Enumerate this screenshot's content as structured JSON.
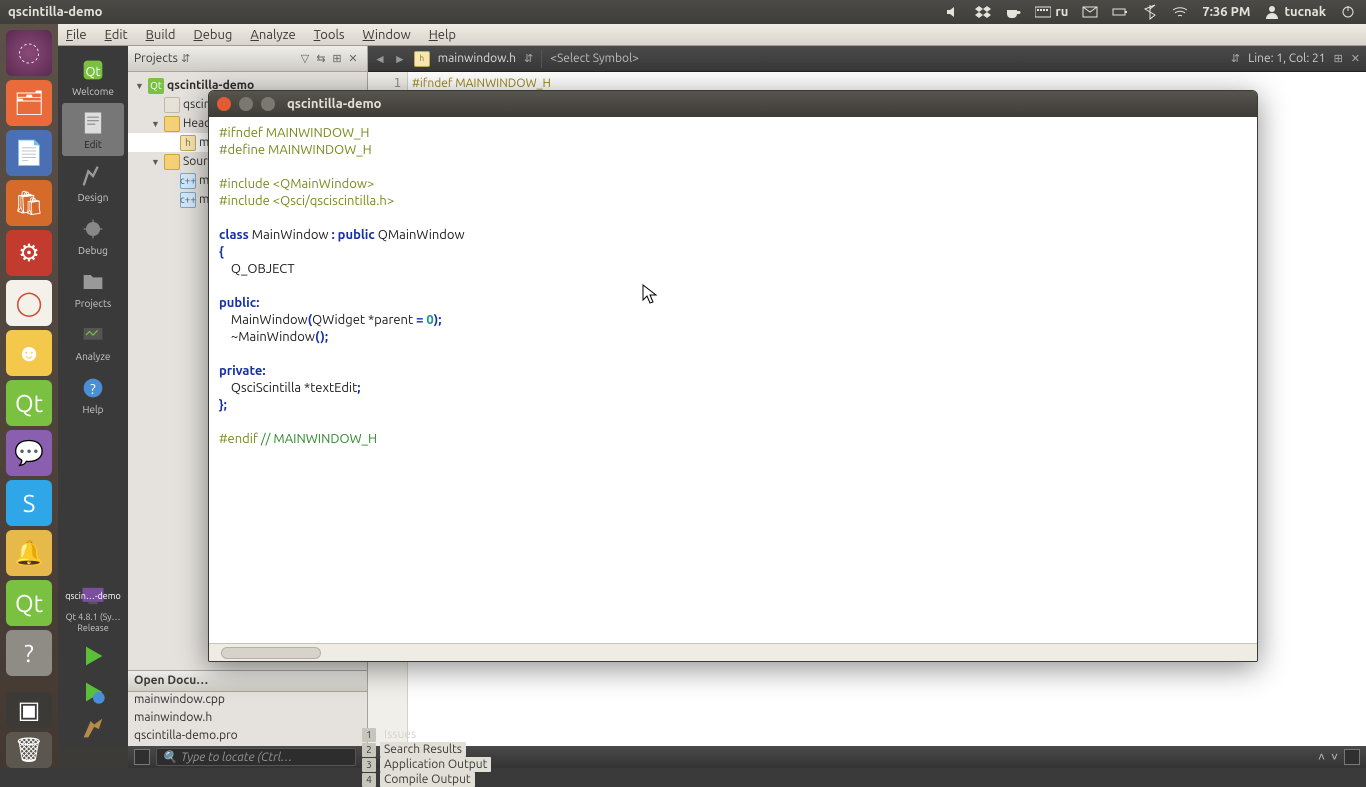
{
  "panel": {
    "title": "qscintilla-demo",
    "lang": "ru",
    "time": "7:36 PM",
    "user": "tucnak"
  },
  "unity": {
    "running_label": "qscin…-demo"
  },
  "menus": [
    "File",
    "Edit",
    "Build",
    "Debug",
    "Analyze",
    "Tools",
    "Window",
    "Help"
  ],
  "modes": {
    "items": [
      "Welcome",
      "Edit",
      "Design",
      "Debug",
      "Projects",
      "Analyze",
      "Help"
    ],
    "active": "Edit",
    "kit_line1": "Qt 4.8.1 (Sy…",
    "kit_line2": "Release"
  },
  "projects": {
    "header": "Projects",
    "tree": [
      {
        "depth": 0,
        "twisty": "▼",
        "icon": "qt",
        "label": "qscintilla-demo",
        "bold": true
      },
      {
        "depth": 1,
        "twisty": "",
        "icon": "pro",
        "label": "qscintilla-demo.pro"
      },
      {
        "depth": 1,
        "twisty": "▼",
        "icon": "fld",
        "label": "Headers"
      },
      {
        "depth": 2,
        "twisty": "",
        "icon": "h",
        "label": "mainwindow.h",
        "sel": true
      },
      {
        "depth": 1,
        "twisty": "▼",
        "icon": "fld",
        "label": "Sources"
      },
      {
        "depth": 2,
        "twisty": "",
        "icon": "cpp",
        "label": "main.cpp"
      },
      {
        "depth": 2,
        "twisty": "",
        "icon": "cpp",
        "label": "mainwindow.cpp"
      }
    ],
    "open_header": "Open Docu…",
    "open_docs": [
      "mainwindow.cpp",
      "mainwindow.h",
      "qscintilla-demo.pro"
    ]
  },
  "editor_header": {
    "file": "mainwindow.h",
    "symbol": "<Select Symbol>",
    "pos": "Line: 1, Col: 21"
  },
  "editor_body": {
    "gutter": "1",
    "peek": "#ifndef MAINWINDOW_H"
  },
  "status": {
    "placeholder": "Type to locate (Ctrl…",
    "panes": [
      {
        "n": "1",
        "l": "Issues"
      },
      {
        "n": "2",
        "l": "Search Results"
      },
      {
        "n": "3",
        "l": "Application Output"
      },
      {
        "n": "4",
        "l": "Compile Output"
      }
    ]
  },
  "demo": {
    "title": "qscintilla-demo",
    "code": [
      {
        "t": "pp",
        "s": "#ifndef MAINWINDOW_H"
      },
      {
        "t": "pp",
        "s": "#define MAINWINDOW_H"
      },
      {
        "t": "",
        "s": ""
      },
      {
        "t": "pp",
        "s": "#include <QMainWindow>"
      },
      {
        "t": "pp",
        "s": "#include <Qsci/qsciscintilla.h>"
      },
      {
        "t": "",
        "s": ""
      },
      {
        "t": "mix",
        "s": "<span class='kw'>class</span><span class='pl'> MainWindow </span><span class='kw'>:</span><span class='pl'> </span><span class='kw'>public</span><span class='pl'> QMainWindow</span>"
      },
      {
        "t": "kw",
        "s": "{"
      },
      {
        "t": "pl",
        "s": "    Q_OBJECT"
      },
      {
        "t": "",
        "s": ""
      },
      {
        "t": "kw",
        "s": "public:"
      },
      {
        "t": "mix",
        "s": "<span class='pl'>    MainWindow</span><span class='kw'>(</span><span class='pl'>QWidget *parent </span><span class='kw'>=</span><span class='pl'> </span><span class='num'>0</span><span class='kw'>);</span>"
      },
      {
        "t": "mix",
        "s": "<span class='pl'>    ~MainWindow</span><span class='kw'>();</span>"
      },
      {
        "t": "",
        "s": ""
      },
      {
        "t": "kw",
        "s": "private:"
      },
      {
        "t": "mix",
        "s": "<span class='pl'>    QsciScintilla *textEdit</span><span class='kw'>;</span>"
      },
      {
        "t": "kw",
        "s": "};"
      },
      {
        "t": "",
        "s": ""
      },
      {
        "t": "mix",
        "s": "<span class='pp'>#endif </span><span class='cm'>// MAINWINDOW_H</span>"
      }
    ]
  }
}
